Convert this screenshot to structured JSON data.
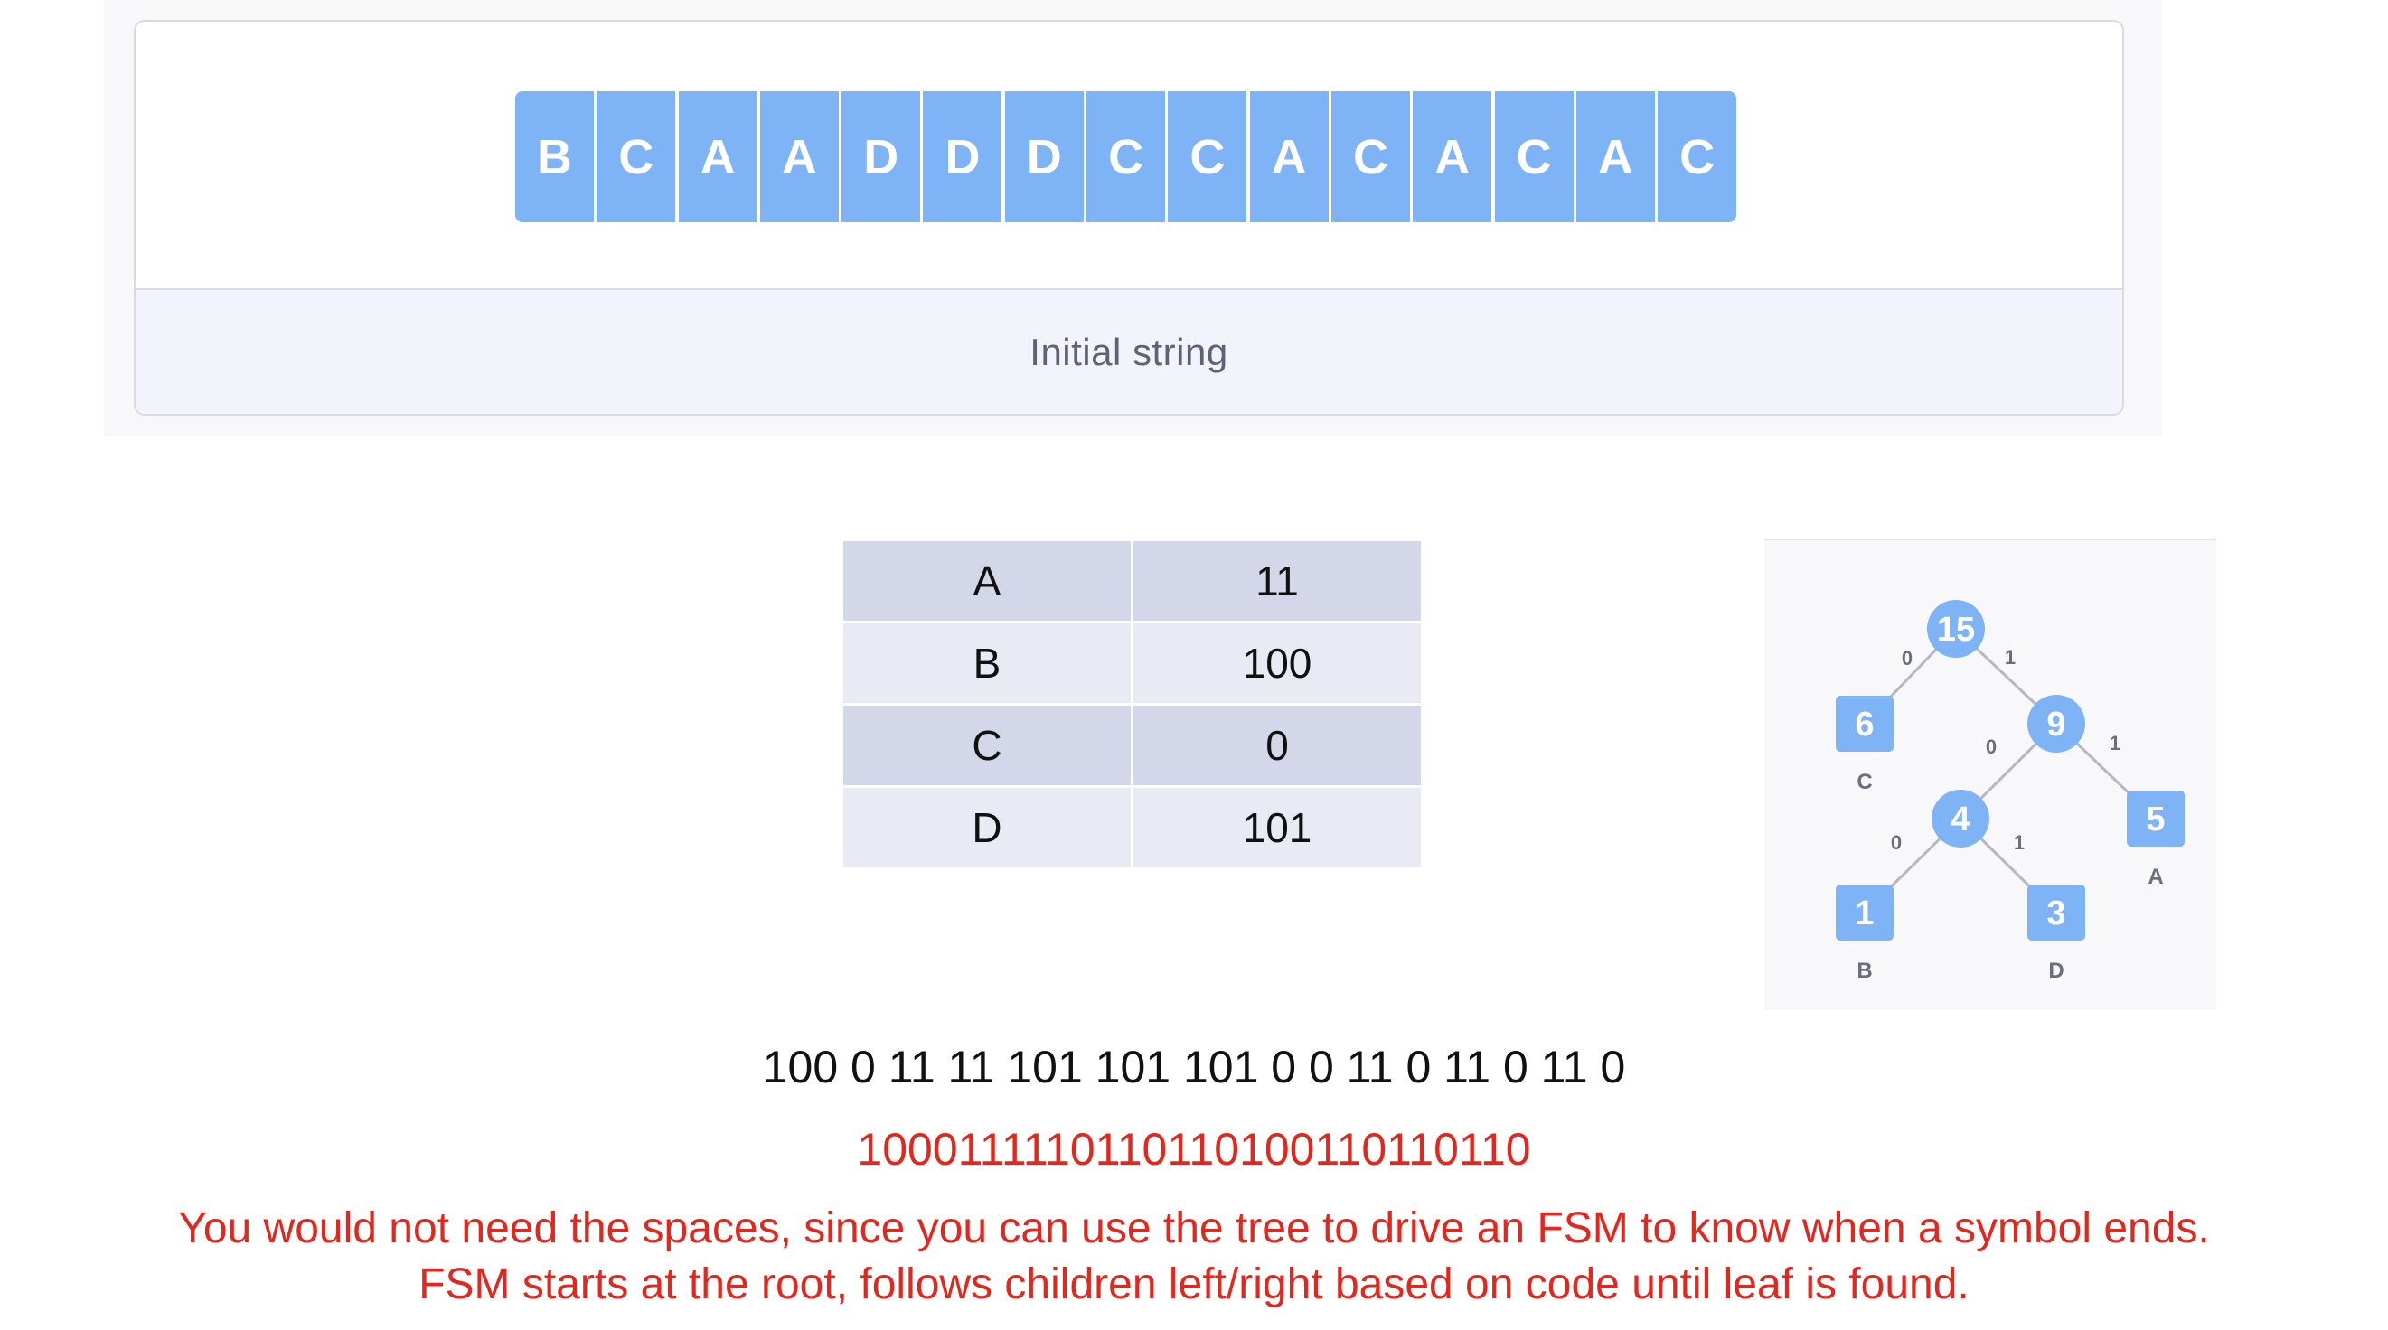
{
  "string_panel": {
    "characters": [
      "B",
      "C",
      "A",
      "A",
      "D",
      "D",
      "D",
      "C",
      "C",
      "A",
      "C",
      "A",
      "C",
      "A",
      "C"
    ],
    "caption": "Initial string"
  },
  "code_table": {
    "rows": [
      {
        "symbol": "A",
        "code": "11"
      },
      {
        "symbol": "B",
        "code": "100"
      },
      {
        "symbol": "C",
        "code": "0"
      },
      {
        "symbol": "D",
        "code": "101"
      }
    ]
  },
  "tree": {
    "nodes": [
      {
        "id": "root",
        "value": "15",
        "shape": "circle"
      },
      {
        "id": "c",
        "value": "6",
        "shape": "square",
        "symbol": "C"
      },
      {
        "id": "n9",
        "value": "9",
        "shape": "circle"
      },
      {
        "id": "n4",
        "value": "4",
        "shape": "circle"
      },
      {
        "id": "a",
        "value": "5",
        "shape": "square",
        "symbol": "A"
      },
      {
        "id": "b",
        "value": "1",
        "shape": "square",
        "symbol": "B"
      },
      {
        "id": "d",
        "value": "3",
        "shape": "square",
        "symbol": "D"
      }
    ],
    "edges": [
      {
        "from": "root",
        "to": "c",
        "label": "0"
      },
      {
        "from": "root",
        "to": "n9",
        "label": "1"
      },
      {
        "from": "n9",
        "to": "n4",
        "label": "0"
      },
      {
        "from": "n9",
        "to": "a",
        "label": "1"
      },
      {
        "from": "n4",
        "to": "b",
        "label": "0"
      },
      {
        "from": "n4",
        "to": "d",
        "label": "1"
      }
    ],
    "colors": {
      "node_fill": "#7eb4f6",
      "node_text": "#ffffff",
      "edge": "#b5b8c4",
      "label": "#6b6e7d"
    }
  },
  "encoding": {
    "spaced": "100 0 11 11 101 101 101 0 0 11 0 11 0 11 0",
    "bits": "1000111110110110100110110110"
  },
  "notes": {
    "line1": "You would not need the spaces, since you can use the tree to drive an FSM to know when a symbol ends.",
    "line2": "FSM starts at the root, follows children left/right based on code until leaf is found."
  }
}
